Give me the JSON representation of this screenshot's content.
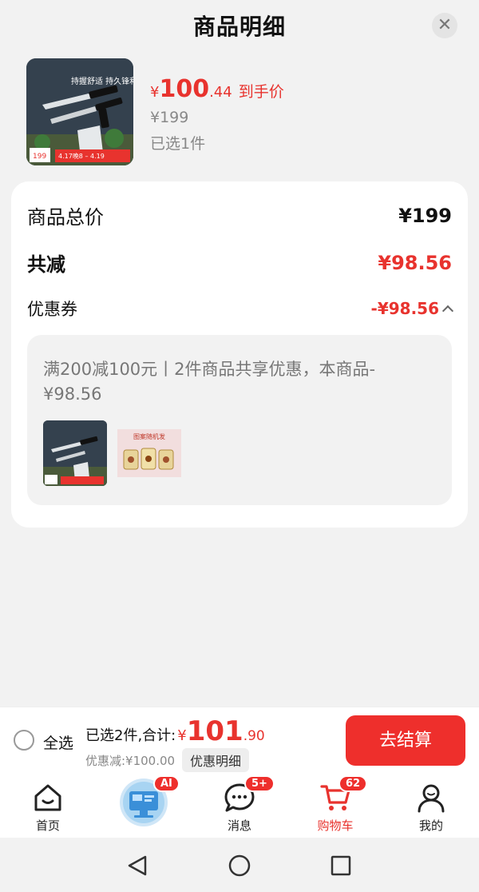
{
  "sheet": {
    "title": "商品明细",
    "close_icon": "close-icon"
  },
  "product": {
    "price_currency": "¥",
    "price_int": "100",
    "price_dec": ".44",
    "price_tag": "到手价",
    "original_price": "¥199",
    "selected_count": "已选1件",
    "thumb_caption": "持握舒适 持久锋利",
    "thumb_badge": "199",
    "thumb_promo": "4.17晚8 – 4.19"
  },
  "summary": {
    "total_label": "商品总价",
    "total_value": "¥199",
    "discount_label": "共减",
    "discount_value": "¥98.56",
    "coupon_label": "优惠券",
    "coupon_value": "-¥98.56",
    "coupon_desc": "满200减100元丨2件商品共享优惠，本商品-¥98.56",
    "mini2_caption": "图案随机发"
  },
  "checkout_bar": {
    "select_all": "全选",
    "summary_label": "已选2件,合计:",
    "total_currency": "¥",
    "total_int": "101",
    "total_dec": ".90",
    "discount_text": "优惠减:¥100.00",
    "detail_button": "优惠明细",
    "checkout_button": "去结算"
  },
  "tabbar": {
    "tabs": [
      {
        "label": "首页",
        "icon": "home-icon"
      },
      {
        "label": "",
        "icon": "ai-assistant-icon",
        "badge": "AI"
      },
      {
        "label": "消息",
        "icon": "message-icon",
        "badge": "5+"
      },
      {
        "label": "购物车",
        "icon": "cart-icon",
        "badge": "62",
        "active": true
      },
      {
        "label": "我的",
        "icon": "profile-icon"
      }
    ]
  },
  "colors": {
    "accent": "#e8332e",
    "checkout_bg": "#ee2f2c"
  }
}
